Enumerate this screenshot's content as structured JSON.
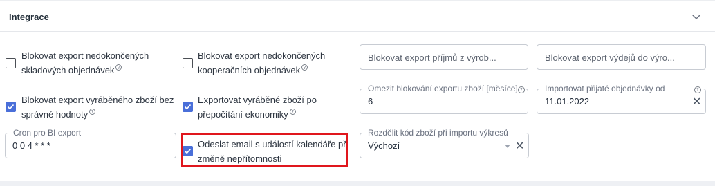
{
  "panel": {
    "title": "Integrace"
  },
  "checkboxes": [
    {
      "line1": "Blokovat export nedokončených",
      "line2": "skladových objednávek",
      "checked": false,
      "help": "?"
    },
    {
      "line1": "Blokovat export nedokončených",
      "line2": "kooperačních objednávek",
      "checked": false,
      "help": "?"
    },
    {
      "line1": "Blokovat export vyráběného zboží bez",
      "line2": "správné hodnoty",
      "checked": true,
      "help": "?"
    },
    {
      "line1": "Exportovat vyráběné zboží po",
      "line2": "přepočítání ekonomiky",
      "checked": true,
      "help": "?"
    },
    {
      "line1": "Odeslat email s událostí kalendáře při",
      "line2": "změně nepřítomnosti",
      "checked": true
    }
  ],
  "fields": {
    "block_income": {
      "placeholder": "Blokovat export příjmů z výrob..."
    },
    "block_expense": {
      "placeholder": "Blokovat export výdejů do výro..."
    },
    "limit_goods": {
      "label": "Omezit blokování exportu zboží [měsíce]",
      "value": "6",
      "help": "?"
    },
    "import_orders": {
      "label": "Importovat přijaté objednávky od",
      "value": "11.01.2022",
      "help": "?",
      "clear": "✕"
    },
    "cron": {
      "label": "Cron pro BI export",
      "value": "0 0 4 * * *"
    },
    "split_code": {
      "label": "Rozdělit kód zboží při importu výkresů",
      "value": "Výchozí",
      "clear": "✕"
    }
  },
  "icons": {
    "chevron": "chevron-down-icon",
    "check": "check-icon",
    "help": "help-circle-icon",
    "clear": "close-icon",
    "caret": "caret-down-icon"
  },
  "colors": {
    "accent": "#4a6fd9",
    "highlight": "#e0161d",
    "border": "#c8ccd3"
  }
}
